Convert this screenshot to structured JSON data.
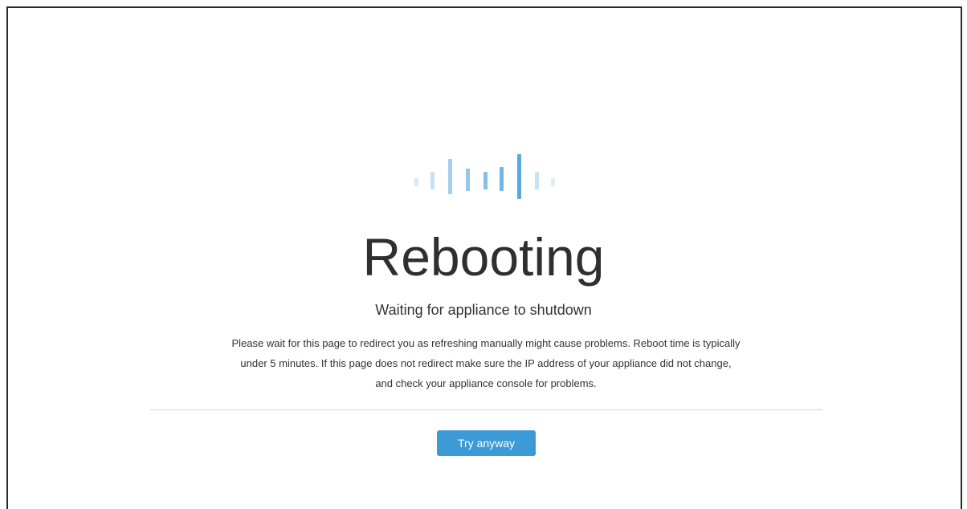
{
  "logo": {
    "icon": "cisco-bars-icon",
    "color": "#5aa9de"
  },
  "main": {
    "title": "Rebooting",
    "subtitle": "Waiting for appliance to shutdown",
    "message_line1": "Please wait for this page to redirect you as refreshing manually might cause problems. Reboot time is typically",
    "message_line2": "under 5 minutes. If this page does not redirect make sure the IP address of your appliance did not change,",
    "message_line3": "and check your appliance console for problems."
  },
  "actions": {
    "try_anyway_label": "Try anyway",
    "button_color": "#3c9ad6"
  }
}
